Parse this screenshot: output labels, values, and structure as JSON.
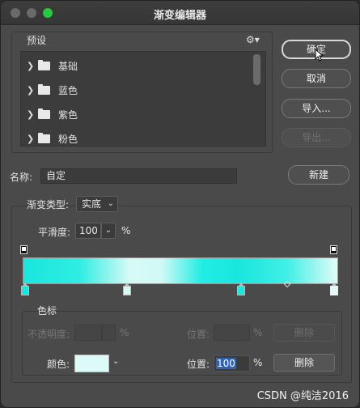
{
  "window": {
    "title": "渐变编辑器"
  },
  "presets": {
    "title": "预设",
    "gear_icon": "gear-icon",
    "folders": [
      {
        "label": "基础"
      },
      {
        "label": "蓝色"
      },
      {
        "label": "紫色"
      },
      {
        "label": "粉色"
      }
    ]
  },
  "buttons": {
    "ok": "确定",
    "cancel": "取消",
    "import": "导入...",
    "export": "导出...",
    "new": "新建"
  },
  "name": {
    "label": "名称:",
    "value": "自定"
  },
  "gradient": {
    "type_label": "渐变类型:",
    "type_value": "实底",
    "smoothness_label": "平滑度:",
    "smoothness_value": "100",
    "smoothness_unit": "%",
    "bar_colors": [
      "#19e6dd",
      "#30ede2",
      "#d8faf6",
      "#d0f9f5",
      "#21ede4",
      "#19e6dd",
      "#40efe5",
      "#e2fbf8"
    ]
  },
  "color_stops": {
    "title": "色标",
    "opacity_label": "不透明度:",
    "opacity_unit": "%",
    "position_label_top": "位置:",
    "position_unit_top": "%",
    "delete_top": "删除",
    "color_label": "颜色:",
    "color_value": "#dcfaf7",
    "position_label": "位置:",
    "position_value": "100",
    "position_unit": "%",
    "delete": "删除"
  },
  "watermark": "CSDN @纯洁2016"
}
